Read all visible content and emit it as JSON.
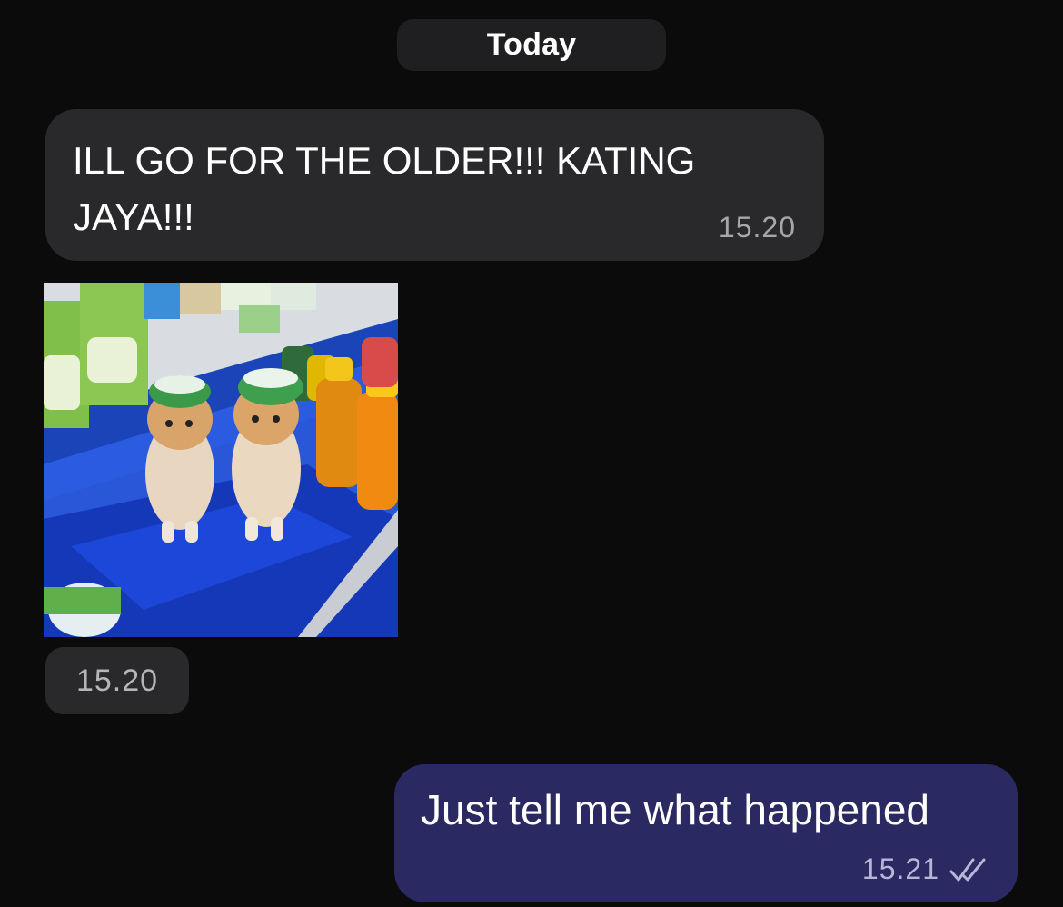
{
  "conversation": {
    "date_separator": "Today"
  },
  "messages": [
    {
      "direction": "incoming",
      "type": "text",
      "text": "ILL GO FOR THE OLDER!!! KATING JAYA!!!",
      "time": "15.20"
    },
    {
      "direction": "incoming",
      "type": "image",
      "image_subject": "two kittens wearing yogurt cup hats in a store fridge",
      "time": "15.20"
    },
    {
      "direction": "outgoing",
      "type": "text",
      "text": "Just tell me what happened",
      "time": "15.21",
      "status_icon": "double-check-icon"
    }
  ],
  "colors": {
    "background": "#0b0b0c",
    "incoming_bubble": "#29292b",
    "outgoing_bubble": "#2a2961",
    "date_pill": "#1f1f21",
    "timestamp_incoming": "#a7a7ab",
    "timestamp_outgoing": "#b7b6d7"
  }
}
